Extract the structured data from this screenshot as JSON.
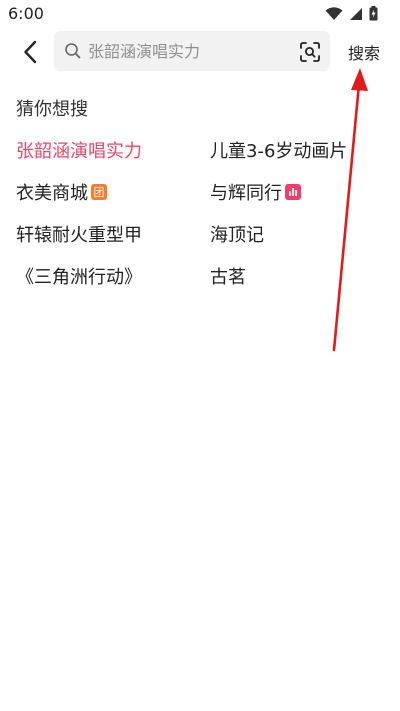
{
  "status_bar": {
    "time": "6:00",
    "icons": [
      "wifi-icon",
      "signal-icon",
      "battery-charging-icon"
    ]
  },
  "search": {
    "placeholder": "张韶涵演唱实力",
    "value": "",
    "submit_label": "搜索"
  },
  "suggestions": {
    "title": "猜你想搜",
    "items": [
      {
        "text": "张韶涵演唱实力",
        "hot": true,
        "badge": null
      },
      {
        "text": "儿童3-6岁动画片",
        "hot": false,
        "badge": null
      },
      {
        "text": "衣美商城",
        "hot": false,
        "badge": "团"
      },
      {
        "text": "与辉同行",
        "hot": false,
        "badge": "chart-icon"
      },
      {
        "text": "轩辕耐火重型甲",
        "hot": false,
        "badge": null
      },
      {
        "text": "海顶记",
        "hot": false,
        "badge": null
      },
      {
        "text": "《三角洲行动》",
        "hot": false,
        "badge": null
      },
      {
        "text": "古茗",
        "hot": false,
        "badge": null
      }
    ]
  },
  "colors": {
    "hot_text": "#e8476a",
    "search_bg": "#f2f2f2",
    "annotation_arrow": "#e01b1b"
  }
}
